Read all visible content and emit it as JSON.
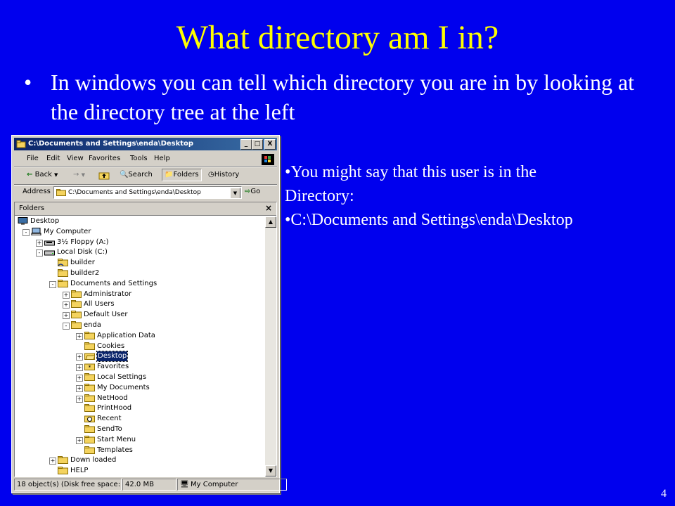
{
  "slide": {
    "title": "What directory am I in?",
    "bullet_main": "In windows you can tell which directory you are in by looking at the directory tree at the left",
    "notes": [
      "You might say that this user is in the",
      "Directory:",
      "C:\\Documents and Settings\\enda\\Desktop"
    ],
    "page_number": "4",
    "bullet_char": "•"
  },
  "window": {
    "title": "C:\\Documents and Settings\\enda\\Desktop",
    "buttons": {
      "minimize": "_",
      "maximize": "□",
      "close": "X"
    },
    "menu": [
      "File",
      "Edit",
      "View",
      "Favorites",
      "Tools",
      "Help"
    ],
    "toolbar": {
      "back": "Back",
      "search": "Search",
      "folders": "Folders",
      "history": "History"
    },
    "address": {
      "label": "Address",
      "value": "C:\\Documents and Settings\\enda\\Desktop",
      "go": "Go"
    },
    "pane": {
      "title": "Folders",
      "close": "×"
    },
    "status": {
      "objects": "18 object(s) (Disk free space: ·",
      "size": "42.0 MB",
      "zone": "My Computer"
    }
  },
  "tree": [
    {
      "label": "Desktop",
      "level": 0,
      "expander": "",
      "icon": "desktop"
    },
    {
      "label": "My Computer",
      "level": 1,
      "expander": "-",
      "icon": "computer"
    },
    {
      "label": "3½ Floppy (A:)",
      "level": 2,
      "expander": "+",
      "icon": "floppy"
    },
    {
      "label": "Local Disk (C:)",
      "level": 2,
      "expander": "-",
      "icon": "disk"
    },
    {
      "label": "builder",
      "level": 3,
      "expander": "",
      "icon": "folder-shared"
    },
    {
      "label": "builder2",
      "level": 3,
      "expander": "",
      "icon": "folder"
    },
    {
      "label": "Documents and Settings",
      "level": 3,
      "expander": "-",
      "icon": "folder"
    },
    {
      "label": "Administrator",
      "level": 4,
      "expander": "+",
      "icon": "folder"
    },
    {
      "label": "All Users",
      "level": 4,
      "expander": "+",
      "icon": "folder"
    },
    {
      "label": "Default User",
      "level": 4,
      "expander": "+",
      "icon": "folder"
    },
    {
      "label": "enda",
      "level": 4,
      "expander": "-",
      "icon": "folder"
    },
    {
      "label": "Application Data",
      "level": 5,
      "expander": "+",
      "icon": "folder"
    },
    {
      "label": "Cookies",
      "level": 5,
      "expander": "",
      "icon": "folder"
    },
    {
      "label": "Desktop",
      "level": 5,
      "expander": "+",
      "icon": "folder-open",
      "selected": true
    },
    {
      "label": "Favorites",
      "level": 5,
      "expander": "+",
      "icon": "folder-star"
    },
    {
      "label": "Local Settings",
      "level": 5,
      "expander": "+",
      "icon": "folder"
    },
    {
      "label": "My Documents",
      "level": 5,
      "expander": "+",
      "icon": "folder"
    },
    {
      "label": "NetHood",
      "level": 5,
      "expander": "+",
      "icon": "folder"
    },
    {
      "label": "PrintHood",
      "level": 5,
      "expander": "",
      "icon": "folder"
    },
    {
      "label": "Recent",
      "level": 5,
      "expander": "",
      "icon": "folder-recent"
    },
    {
      "label": "SendTo",
      "level": 5,
      "expander": "",
      "icon": "folder"
    },
    {
      "label": "Start Menu",
      "level": 5,
      "expander": "+",
      "icon": "folder"
    },
    {
      "label": "Templates",
      "level": 5,
      "expander": "",
      "icon": "folder"
    },
    {
      "label": "Down loaded",
      "level": 3,
      "expander": "+",
      "icon": "folder"
    },
    {
      "label": "HELP",
      "level": 3,
      "expander": "",
      "icon": "folder"
    }
  ]
}
